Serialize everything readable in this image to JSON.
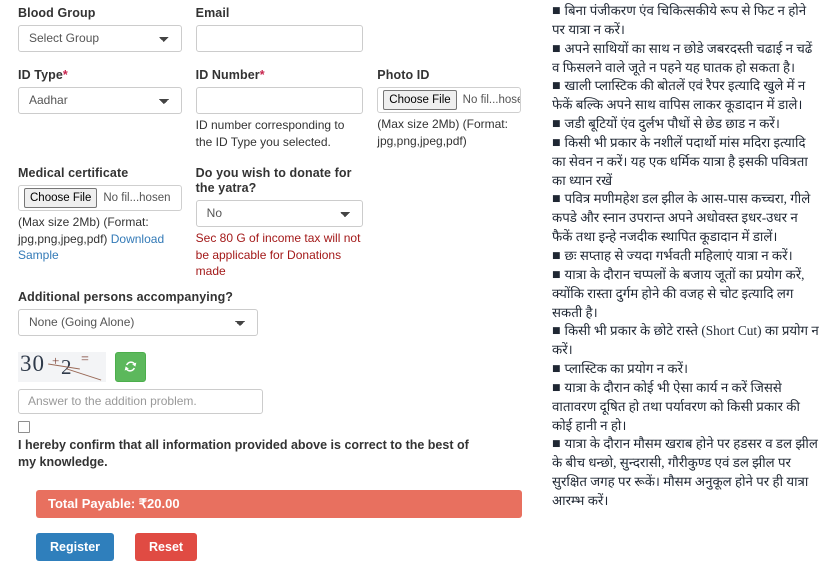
{
  "form": {
    "blood_group": {
      "label": "Blood Group",
      "value": "Select Group"
    },
    "email": {
      "label": "Email",
      "value": "",
      "placeholder": ""
    },
    "id_type": {
      "label": "ID Type",
      "required_mark": "*",
      "value": "Aadhar"
    },
    "id_number": {
      "label": "ID Number",
      "required_mark": "*",
      "value": "",
      "placeholder": "",
      "helper": "ID number corresponding to the ID Type you selected."
    },
    "photo_id": {
      "label": "Photo ID",
      "choose_button": "Choose File",
      "no_file_text": "No fil...hosen",
      "helper": "(Max size 2Mb) (Format: jpg,png,jpeg,pdf)"
    },
    "medical_certificate": {
      "label": "Medical certificate",
      "choose_button": "Choose File",
      "no_file_text": "No fil...hosen",
      "helper": "(Max size 2Mb) (Format: jpg,png,jpeg,pdf)",
      "download_link": "Download Sample"
    },
    "donate": {
      "label": "Do you wish to donate for the yatra?",
      "value": "No",
      "warning": "Sec 80 G of income tax will not be applicable for Donations made"
    },
    "additional_persons": {
      "label": "Additional persons accompanying?",
      "value": "None (Going Alone)"
    },
    "captcha": {
      "number_one": "30",
      "operator": "+",
      "number_two": "2",
      "equals": "=",
      "refresh_icon": "refresh-icon",
      "answer_placeholder": "Answer to the addition problem."
    },
    "confirm": {
      "checked": false,
      "text": "I hereby confirm that all information provided above is correct to the best of my knowledge."
    },
    "total_payable": "Total Payable: ₹20.00",
    "buttons": {
      "register": "Register",
      "reset": "Reset"
    }
  },
  "colors": {
    "register_button": "#2f7fbc",
    "reset_button": "#e04b43",
    "total_banner": "#e8705f",
    "refresh_button": "#5cb85c",
    "warning_text": "#a31919",
    "link": "#337ab7",
    "required_mark": "#c7254e"
  },
  "notices": [
    "बिना पंजीकरण एंव चिकित्सकीये रूप से फिट न होने पर यात्रा न करें।",
    "अपने साथियों का साथ न छोडे जबरदस्ती चढाई न चढें व फिसलने वाले जूते न पहने यह घातक हो सकता है।",
    "खाली प्लास्टिक की बोतलें एवं रैपर इत्यादि खुले में न फेकें बल्कि अपने साथ वापिस लाकर कूडादान में डाले।",
    "जडी बूटियों एंव दुर्लभ पौधों से छेड छाड न करें।",
    "किसी भी प्रकार के नशीलें पदार्थो मांस मदिरा इत्यादि का सेवन न करें। यह एक धर्मिक यात्रा है इसकी पवित्रता का ध्यान रखें",
    "पवित्र मणीमहेश डल झील के आस-पास कच्चरा, गीले कपडे और स्नान उपरान्त अपने अधोवस्त इधर-उधर न फैकें तथा इन्हे नजदीक स्थापित कूडादान में डालें।",
    "छः सप्ताह से ज्यदा गर्भवती महिलाएं यात्रा न करें।",
    "यात्रा के दौरान चप्पलों के बजाय जूतों का प्रयोग करें, क्योंकि रास्ता दुर्गम होने की वजह से चोट इत्यादि लग सकती है।",
    "किसी भी प्रकार के छोटे रास्ते (Short Cut) का प्रयोग न करें।",
    "प्लास्टिक का प्रयोग न करें।",
    "यात्रा के दौरान कोई भी ऐसा कार्य न करें जिससे वातावरण दूषित हो तथा पर्यावरण को किसी प्रकार की कोई हानी न हो।",
    "यात्रा के दौरान मौसम खराब होने पर हडसर व डल झील के बीच धन्छो, सुन्दरासी, गौरीकुण्ड एवं डल झील पर सुरक्षित जगह पर रूकें। मौसम अनुकूल होने पर ही यात्रा आरम्भ करें।"
  ]
}
